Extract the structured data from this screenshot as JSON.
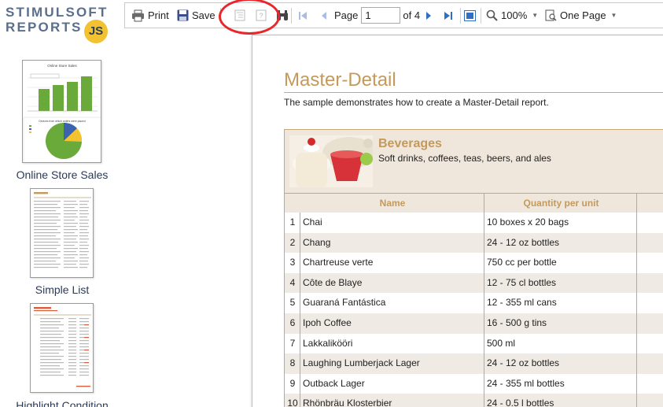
{
  "logo": {
    "line1": "STIMULSOFT",
    "line2": "REPORTS",
    "badge": "JS"
  },
  "toolbar": {
    "print_label": "Print",
    "save_label": "Save",
    "page_label": "Page",
    "page_value": "1",
    "of_label": "of 4",
    "zoom_label": "100%",
    "view_mode_label": "One Page"
  },
  "sidebar": {
    "items": [
      {
        "label": "Online Store Sales",
        "thumb_title": "Online Store Sales",
        "thumb_subtitle": "Devices from which orders were placed"
      },
      {
        "label": "Simple List"
      },
      {
        "label": "Highlight Condition"
      }
    ]
  },
  "report": {
    "title": "Master-Detail",
    "description": "The sample demonstrates how to create a Master-Detail report.",
    "category": {
      "name": "Beverages",
      "description": "Soft drinks, coffees, teas, beers, and ales"
    },
    "columns": [
      "Name",
      "Quantity per unit"
    ],
    "rows": [
      {
        "num": "1",
        "name": "Chai",
        "qty": "10 boxes x 20 bags"
      },
      {
        "num": "2",
        "name": "Chang",
        "qty": "24 - 12 oz bottles"
      },
      {
        "num": "3",
        "name": "Chartreuse verte",
        "qty": "750 cc per bottle"
      },
      {
        "num": "4",
        "name": "Côte de Blaye",
        "qty": "12 - 75 cl bottles"
      },
      {
        "num": "5",
        "name": "Guaraná Fantástica",
        "qty": "12 - 355 ml cans"
      },
      {
        "num": "6",
        "name": "Ipoh Coffee",
        "qty": "16 - 500 g tins"
      },
      {
        "num": "7",
        "name": "Lakkalikööri",
        "qty": "500 ml"
      },
      {
        "num": "8",
        "name": "Laughing Lumberjack Lager",
        "qty": "24 - 12 oz bottles"
      },
      {
        "num": "9",
        "name": "Outback Lager",
        "qty": "24 - 355 ml bottles"
      },
      {
        "num": "10",
        "name": "Rhönbräu Klosterbier",
        "qty": "24 - 0.5 l bottles"
      }
    ]
  },
  "colors": {
    "accent": "#c49a5c",
    "band": "#efe7dc",
    "brand": "#5a6f8c",
    "annotation": "#e8262b"
  }
}
